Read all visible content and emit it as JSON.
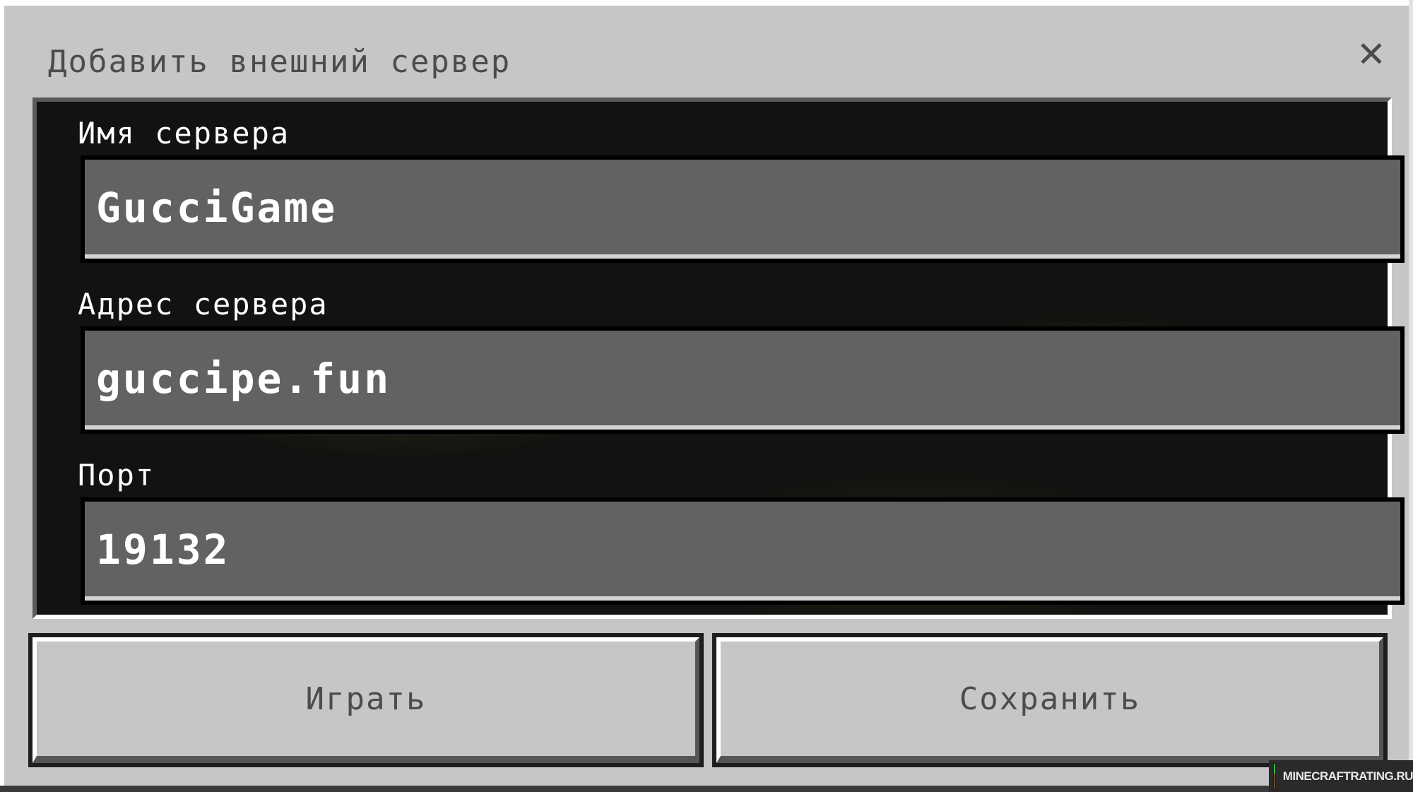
{
  "dialog": {
    "title": "Добавить внешний сервер",
    "close_icon": "close-icon"
  },
  "fields": {
    "server_name": {
      "label": "Имя сервера",
      "value": "GucciGame"
    },
    "server_address": {
      "label": "Адрес сервера",
      "value": "guccipe.fun"
    },
    "port": {
      "label": "Порт",
      "value": "19132"
    }
  },
  "buttons": {
    "play_label": "Играть",
    "save_label": "Сохранить"
  },
  "watermark": {
    "text": "MINECRAFTRATING.RU"
  },
  "colors": {
    "dialog_bg": "#c6c6c6",
    "panel_bg": "#121210",
    "field_bg": "#626262",
    "text_dark": "#4c4c4c",
    "text_light": "#ffffff"
  }
}
